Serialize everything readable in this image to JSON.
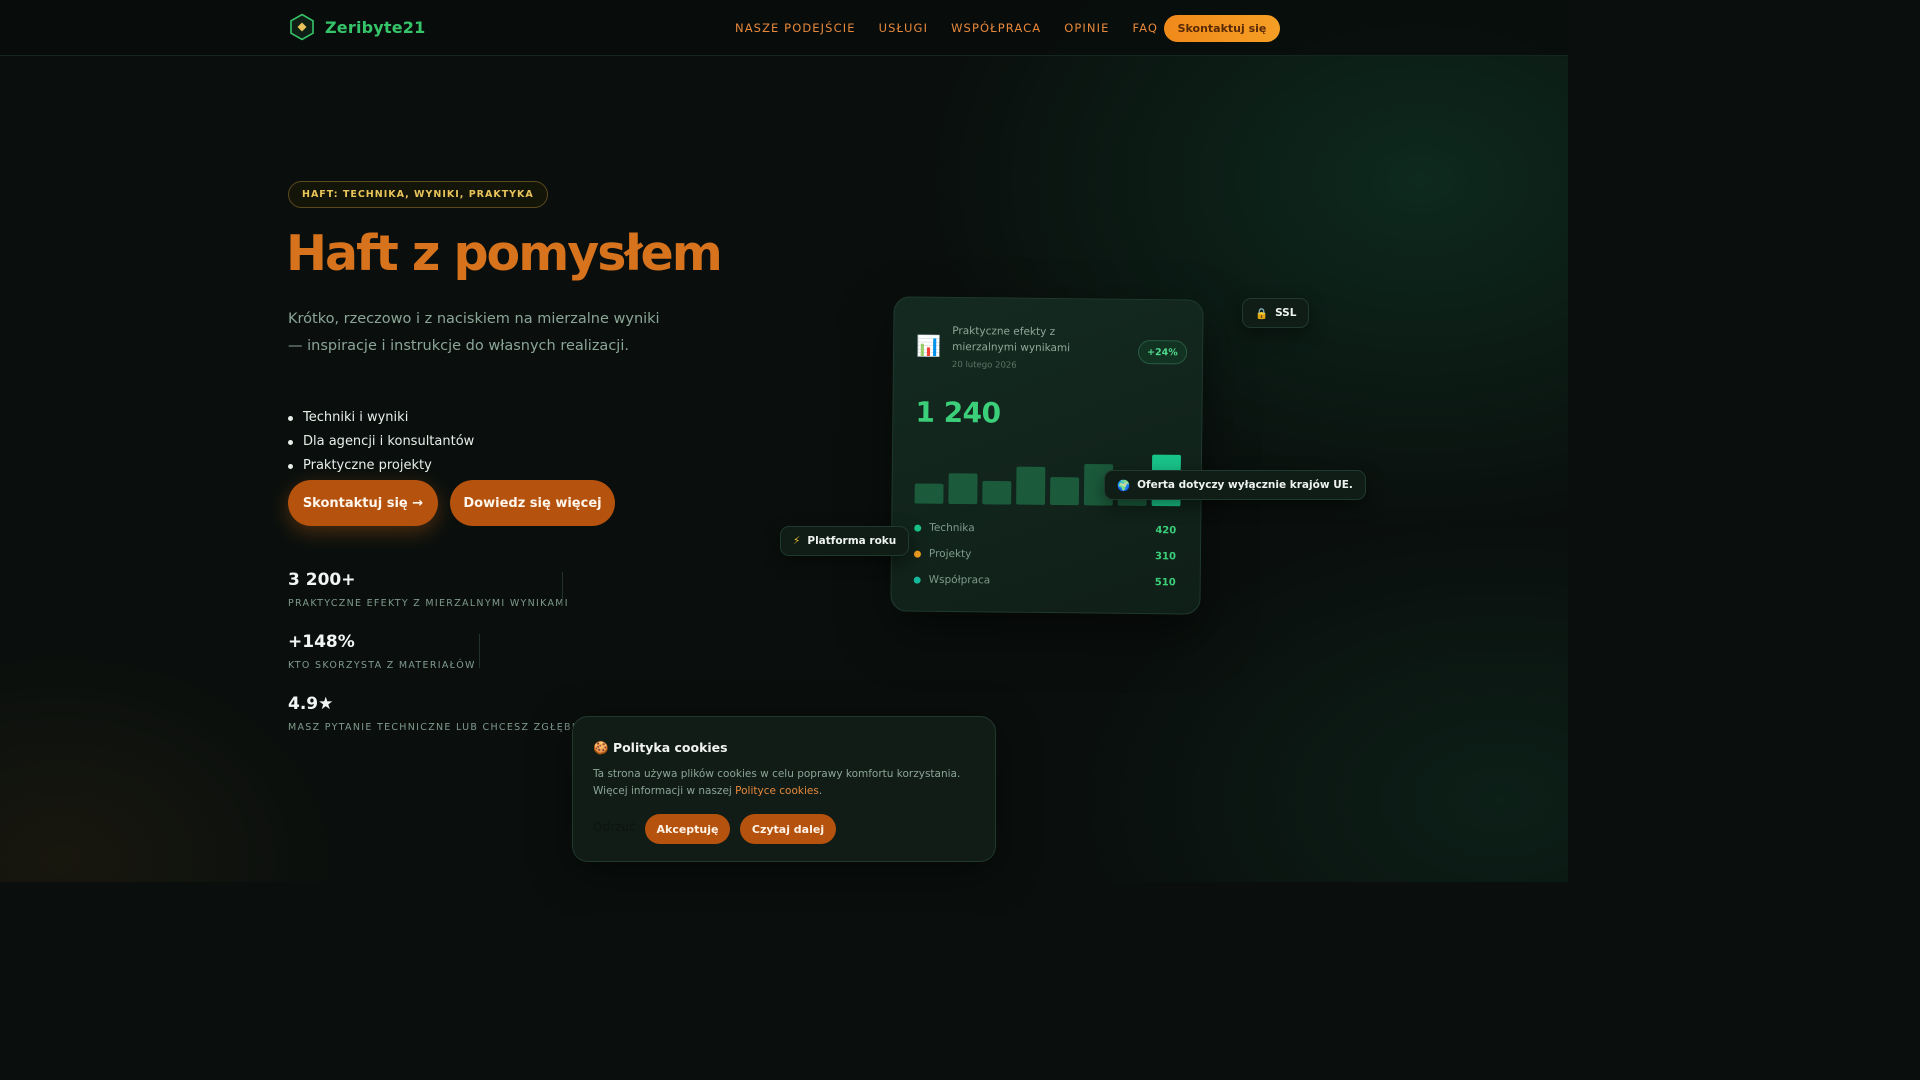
{
  "brand": {
    "name": "Zeribyte21"
  },
  "nav": {
    "links": [
      "NASZE PODEJŚCIE",
      "USŁUGI",
      "WSPÓŁPRACA",
      "OPINIE",
      "FAQ"
    ],
    "cta": "Skontaktuj się"
  },
  "hero": {
    "badge": "HAFT: TECHNIKA, WYNIKI, PRAKTYKA",
    "title": "Haft z pomysłem",
    "subtitle": "Krótko, rzeczowo i z naciskiem na mierzalne wyniki — inspiracje i instrukcje do własnych realizacji.",
    "bullets": [
      "Techniki i wyniki",
      "Dla agencji i konsultantów",
      "Praktyczne projekty"
    ],
    "primary_button": "Skontaktuj się →",
    "secondary_button": "Dowiedz się więcej"
  },
  "stats": [
    {
      "value": "3 200+",
      "label": "PRAKTYCZNE EFEKTY Z MIERZALNYMI WYNIKAMI"
    },
    {
      "value": "+148%",
      "label": "KTO SKORZYSTA Z MATERIAŁÓW"
    },
    {
      "value": "4.9★",
      "label": "MASZ PYTANIE TECHNICZNE LUB CHCESZ ZGŁĘBIĆ TEMAT?"
    }
  ],
  "dashboard": {
    "icon": "bar-chart-icon",
    "title": "Praktyczne efekty z mierzalnymi wynikami",
    "date": "20 lutego 2026",
    "delta": "+24%",
    "total": "1 240",
    "bars": [
      0.36,
      0.55,
      0.42,
      0.68,
      0.5,
      0.74,
      0.6,
      0.92
    ],
    "highlight_bar_index": 7,
    "colors": {
      "bar": "#1b5a3b",
      "bar_highlight": "#18c48a"
    },
    "legend": [
      {
        "label": "Technika",
        "value": "420",
        "color": "#18c48a"
      },
      {
        "label": "Projekty",
        "value": "310",
        "color": "#f0a020"
      },
      {
        "label": "Współpraca",
        "value": "510",
        "color": "#14b89a"
      }
    ]
  },
  "chips": {
    "ssl": {
      "icon": "lock-icon",
      "text": "SSL"
    },
    "eu": {
      "icon": "globe-icon",
      "text": "Oferta dotyczy wyłącznie krajów UE."
    },
    "platform": {
      "icon": "lightning-icon",
      "text": "Platforma roku"
    }
  },
  "cookie": {
    "icon": "cookie-icon",
    "title": "Polityka cookies",
    "text_before": "Ta strona używa plików cookies w celu poprawy komfortu korzystania. Więcej informacji w naszej ",
    "link": "Polityce cookies",
    "text_after": ".",
    "reject": "Odrzuć",
    "accept": "Akceptuję",
    "read_more": "Czytaj dalej"
  }
}
